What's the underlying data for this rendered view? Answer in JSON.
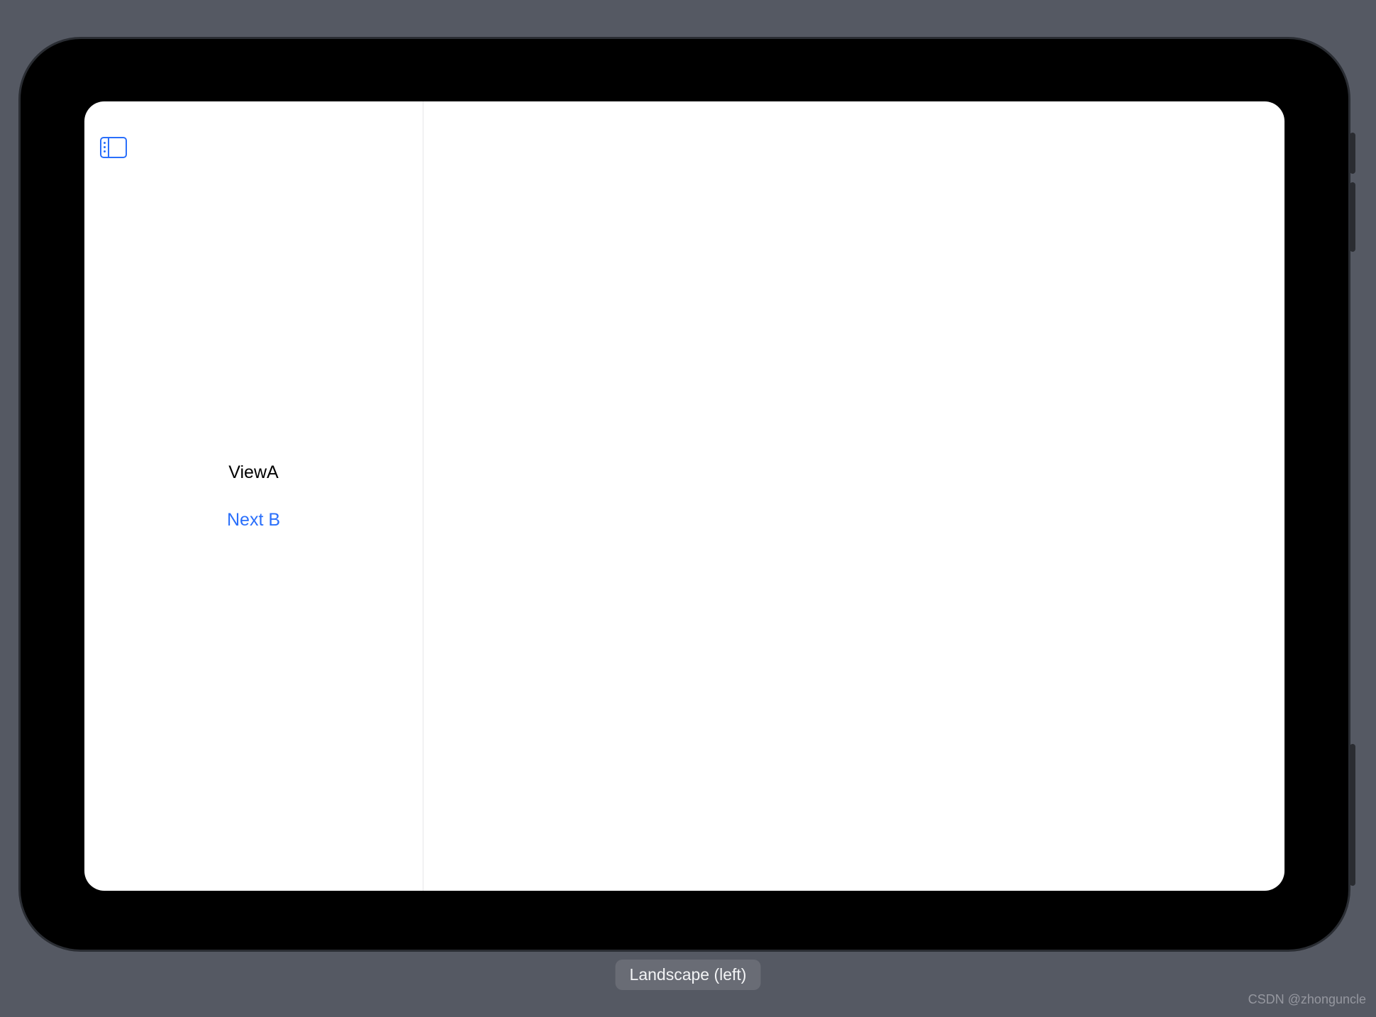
{
  "sidebar": {
    "title": "ViewA",
    "next_link": "Next B"
  },
  "orientation": {
    "label": "Landscape (left)"
  },
  "watermark": {
    "text": "CSDN @zhonguncle"
  },
  "colors": {
    "accent": "#2a6ffb",
    "background": "#555963",
    "device_frame": "#000000"
  },
  "icons": {
    "sidebar_toggle": "sidebar-left-icon"
  }
}
